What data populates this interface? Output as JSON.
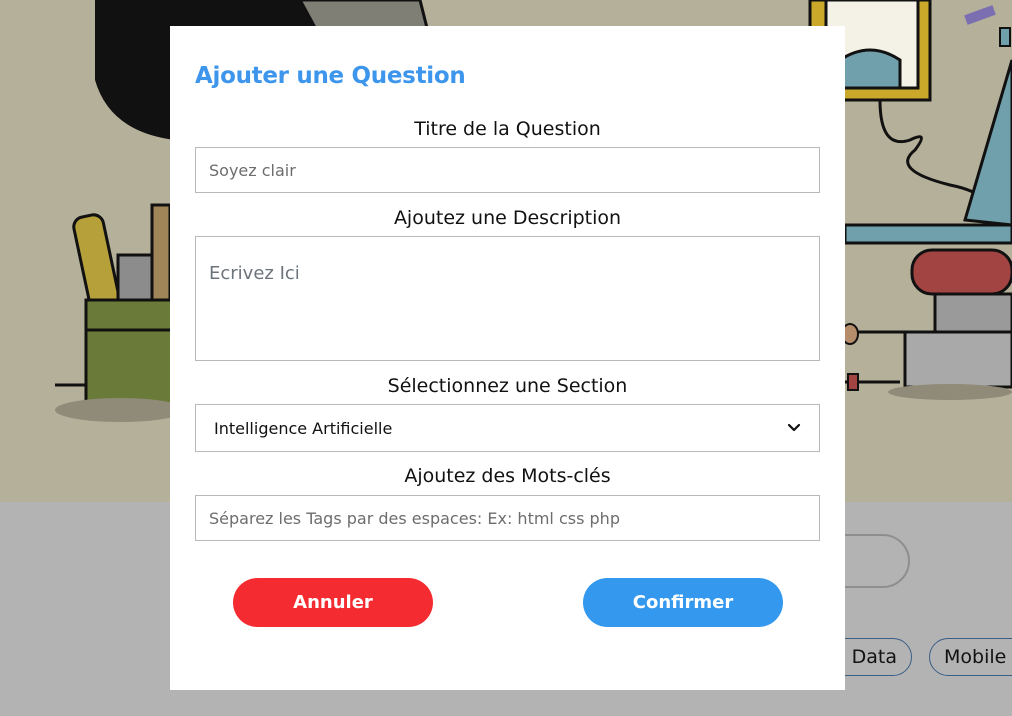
{
  "background": {
    "chips": [
      "Big Data",
      "Mobile"
    ]
  },
  "modal": {
    "title": "Ajouter une Question",
    "question_title": {
      "label": "Titre de la Question",
      "placeholder": "Soyez clair"
    },
    "description": {
      "label": "Ajoutez une Description",
      "placeholder": "Ecrivez Ici"
    },
    "section": {
      "label": "Sélectionnez une Section",
      "selected": "Intelligence Artificielle"
    },
    "keywords": {
      "label": "Ajoutez des Mots-clés",
      "placeholder": "Séparez les Tags par des espaces: Ex: html css php"
    },
    "buttons": {
      "cancel": "Annuler",
      "confirm": "Confirmer"
    }
  },
  "colors": {
    "title": "#3d96ec",
    "cancel": "#f42b30",
    "confirm": "#3398ee",
    "hero_bg": "#b5b09a",
    "overlay_bg": "#b3b3b3"
  },
  "icons": {
    "select_arrow": "chevron-down-icon"
  }
}
